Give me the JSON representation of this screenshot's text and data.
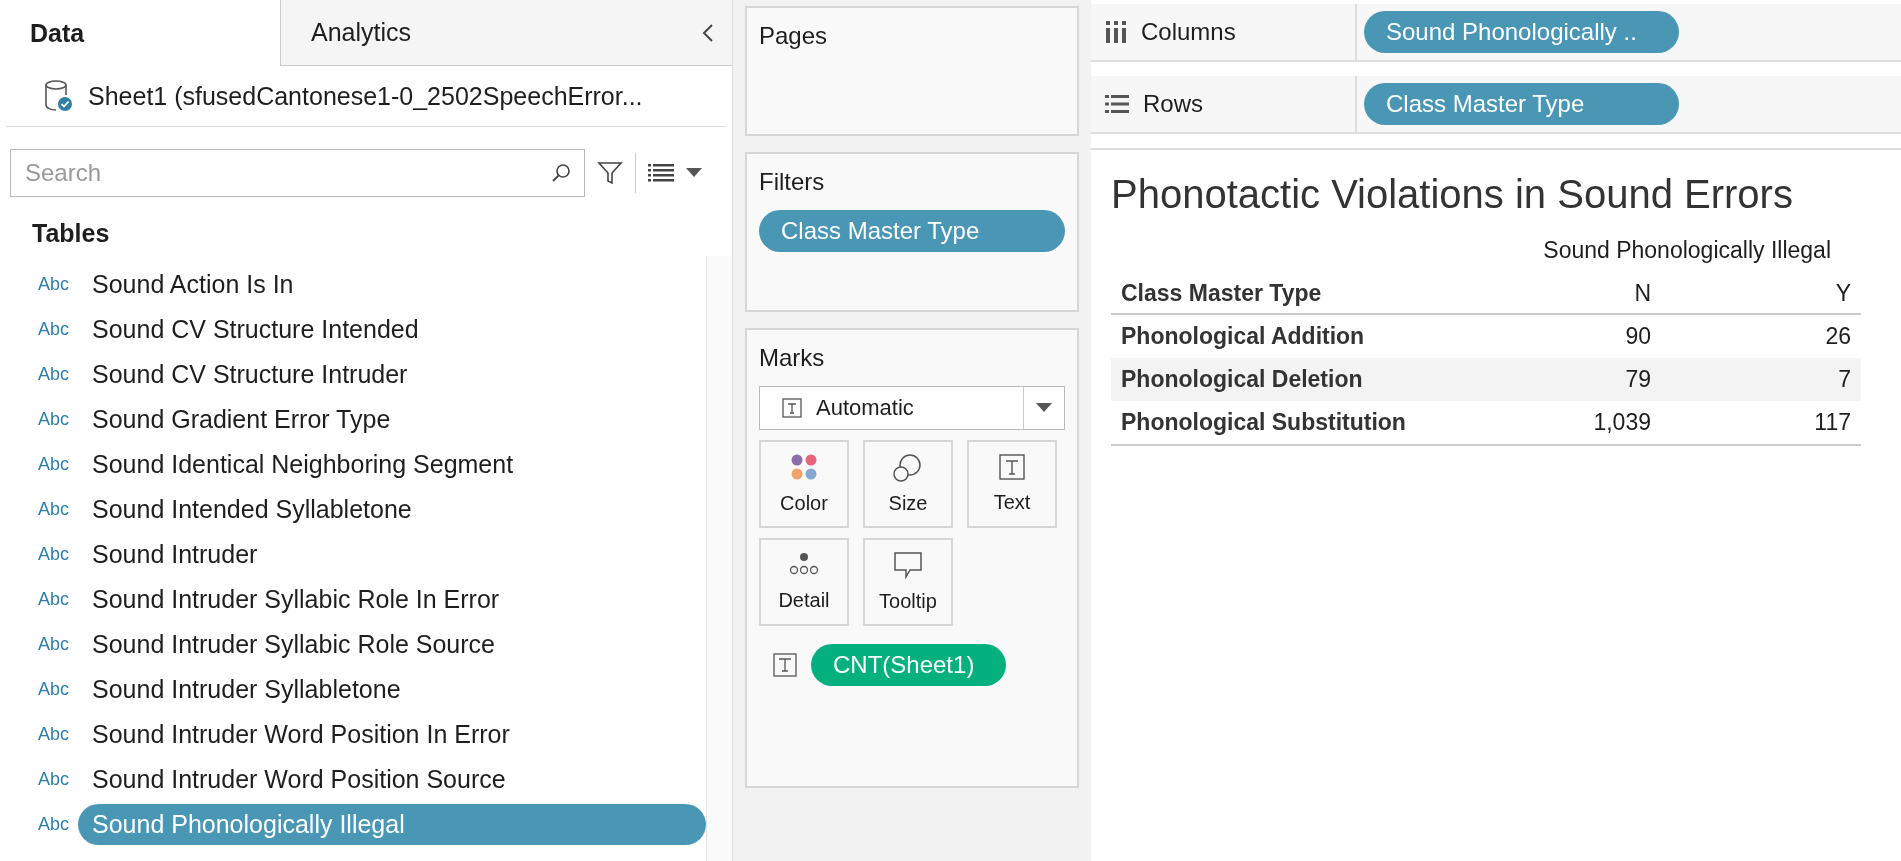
{
  "tabs": [
    {
      "label": "Data",
      "selected": true
    },
    {
      "label": "Analytics",
      "selected": false
    }
  ],
  "data_source": "Sheet1 (sfusedCantonese1-0_2502SpeechError...",
  "search": {
    "placeholder": "Search"
  },
  "tables_heading": "Tables",
  "fields": [
    {
      "type": "Abc",
      "name": "Sound Action Is In",
      "selected": false
    },
    {
      "type": "Abc",
      "name": "Sound CV Structure Intended",
      "selected": false
    },
    {
      "type": "Abc",
      "name": "Sound CV Structure Intruder",
      "selected": false
    },
    {
      "type": "Abc",
      "name": "Sound Gradient Error Type",
      "selected": false
    },
    {
      "type": "Abc",
      "name": "Sound Identical Neighboring Segment",
      "selected": false
    },
    {
      "type": "Abc",
      "name": "Sound Intended Syllabletone",
      "selected": false
    },
    {
      "type": "Abc",
      "name": "Sound Intruder",
      "selected": false
    },
    {
      "type": "Abc",
      "name": "Sound Intruder Syllabic Role In Error",
      "selected": false
    },
    {
      "type": "Abc",
      "name": "Sound Intruder Syllabic Role Source",
      "selected": false
    },
    {
      "type": "Abc",
      "name": "Sound Intruder Syllabletone",
      "selected": false
    },
    {
      "type": "Abc",
      "name": "Sound Intruder Word Position In Error",
      "selected": false
    },
    {
      "type": "Abc",
      "name": "Sound Intruder Word Position Source",
      "selected": false
    },
    {
      "type": "Abc",
      "name": "Sound Phonologically Illegal",
      "selected": true
    }
  ],
  "pages": {
    "title": "Pages"
  },
  "filters": {
    "title": "Filters",
    "pills": [
      {
        "label": "Class Master Type",
        "color": "#4a96b5"
      }
    ]
  },
  "marks": {
    "title": "Marks",
    "mark_type": "Automatic",
    "cards": [
      {
        "kind": "color",
        "label": "Color"
      },
      {
        "kind": "size",
        "label": "Size"
      },
      {
        "kind": "text",
        "label": "Text"
      },
      {
        "kind": "detail",
        "label": "Detail"
      },
      {
        "kind": "tooltip",
        "label": "Tooltip"
      }
    ],
    "fields": [
      {
        "kind": "text",
        "label": "CNT(Sheet1)",
        "color": "#03b07e"
      }
    ]
  },
  "shelves": [
    {
      "kind": "columns",
      "label": "Columns",
      "pills": [
        {
          "label": "Sound Phonologically ..",
          "color": "#4a96b5"
        }
      ]
    },
    {
      "kind": "rows",
      "label": "Rows",
      "pills": [
        {
          "label": "Class Master Type",
          "color": "#4a96b5"
        }
      ]
    }
  ],
  "view": {
    "title": "Phonotactic Violations in Sound Errors",
    "column_header": "Sound Phonologically Illegal",
    "row_header": "Class Master Type",
    "columns": [
      "N",
      "Y"
    ],
    "rows": [
      {
        "label": "Phonological Addition",
        "values": [
          "90",
          "26"
        ],
        "banded": false
      },
      {
        "label": "Phonological Deletion",
        "values": [
          "79",
          "7"
        ],
        "banded": true
      },
      {
        "label": "Phonological Substitution",
        "values": [
          "1,039",
          "117"
        ],
        "banded": false
      }
    ]
  }
}
